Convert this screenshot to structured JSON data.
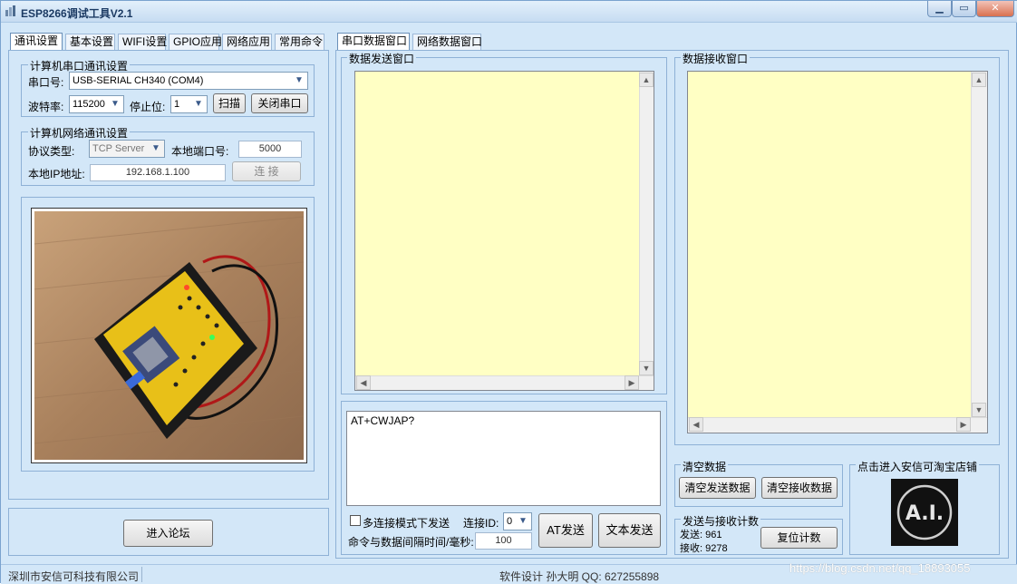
{
  "window": {
    "title": "ESP8266调试工具V2.1"
  },
  "left_tabs": [
    "通讯设置",
    "基本设置",
    "WIFI设置",
    "GPIO应用",
    "网络应用",
    "常用命令"
  ],
  "serial": {
    "group_title": "计算机串口通讯设置",
    "port_label": "串口号:",
    "port_value": "USB-SERIAL CH340 (COM4)",
    "baud_label": "波特率:",
    "baud_value": "115200",
    "stop_label": "停止位:",
    "stop_value": "1",
    "scan_button": "扫描",
    "close_button": "关闭串口"
  },
  "network": {
    "group_title": "计算机网络通讯设置",
    "protocol_label": "协议类型:",
    "protocol_value": "TCP Server",
    "local_port_label": "本地端口号:",
    "local_port_value": "5000",
    "local_ip_label": "本地IP地址:",
    "local_ip_value": "192.168.1.100",
    "connect_button": "连 接"
  },
  "forum_button": "进入论坛",
  "right_tabs": [
    "串口数据窗口",
    "网络数据窗口"
  ],
  "send_window": {
    "title": "数据发送窗口"
  },
  "recv_window": {
    "title": "数据接收窗口"
  },
  "command": {
    "text": "AT+CWJAP?",
    "multi_conn_label": "多连接模式下发送",
    "conn_id_label": "连接ID:",
    "conn_id_value": "0",
    "interval_label": "命令与数据间隔时间/毫秒:",
    "interval_value": "100",
    "at_send_button": "AT发送",
    "text_send_button": "文本发送"
  },
  "clear": {
    "group_title": "清空数据",
    "clear_send_button": "清空发送数据",
    "clear_recv_button": "清空接收数据"
  },
  "counter": {
    "group_title": "发送与接收计数",
    "send_label": "发送: 961",
    "recv_label": "接收: 9278",
    "reset_button": "复位计数"
  },
  "shop": {
    "group_title": "点击进入安信可淘宝店铺",
    "logo_text": "A.I."
  },
  "statusbar": {
    "company": "深圳市安信可科技有限公司",
    "designer": "软件设计 孙大明 QQ: 627255898",
    "watermark": "https://blog.csdn.net/qq_18893055"
  },
  "colors": {
    "window_bg": "#d3e7f8",
    "textarea_bg": "#ffffc4",
    "title_color": "#1b3a63"
  }
}
